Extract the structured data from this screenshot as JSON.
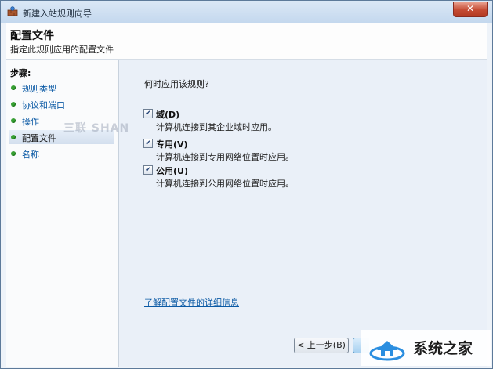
{
  "window": {
    "title": "新建入站规则向导",
    "close_glyph": "✕"
  },
  "header": {
    "title": "配置文件",
    "subtitle": "指定此规则应用的配置文件"
  },
  "steps": {
    "heading": "步骤:",
    "items": [
      {
        "label": "规则类型",
        "active": false
      },
      {
        "label": "协议和端口",
        "active": false
      },
      {
        "label": "操作",
        "active": false
      },
      {
        "label": "配置文件",
        "active": true
      },
      {
        "label": "名称",
        "active": false
      }
    ]
  },
  "main": {
    "question": "何时应用该规则?",
    "options": [
      {
        "name": "域(D)",
        "description": "计算机连接到其企业域时应用。",
        "checked": true
      },
      {
        "name": "专用(V)",
        "description": "计算机连接到专用网络位置时应用。",
        "checked": true
      },
      {
        "name": "公用(U)",
        "description": "计算机连接到公用网络位置时应用。",
        "checked": true
      }
    ],
    "learn_more": "了解配置文件的详细信息"
  },
  "buttons": {
    "back": "< 上一步(B)"
  },
  "watermarks": {
    "center": "三联 SHAN",
    "corner": "系统之家"
  },
  "icons": {
    "app": "firewall-wizard-icon",
    "step_bullet": "green-dot-icon",
    "checkbox": "checkmark-icon",
    "watermark": "house-logo-icon"
  },
  "colors": {
    "step_bullet": "#37a033",
    "link": "#0b5aa5",
    "content_bg": "#eaf0f8"
  }
}
